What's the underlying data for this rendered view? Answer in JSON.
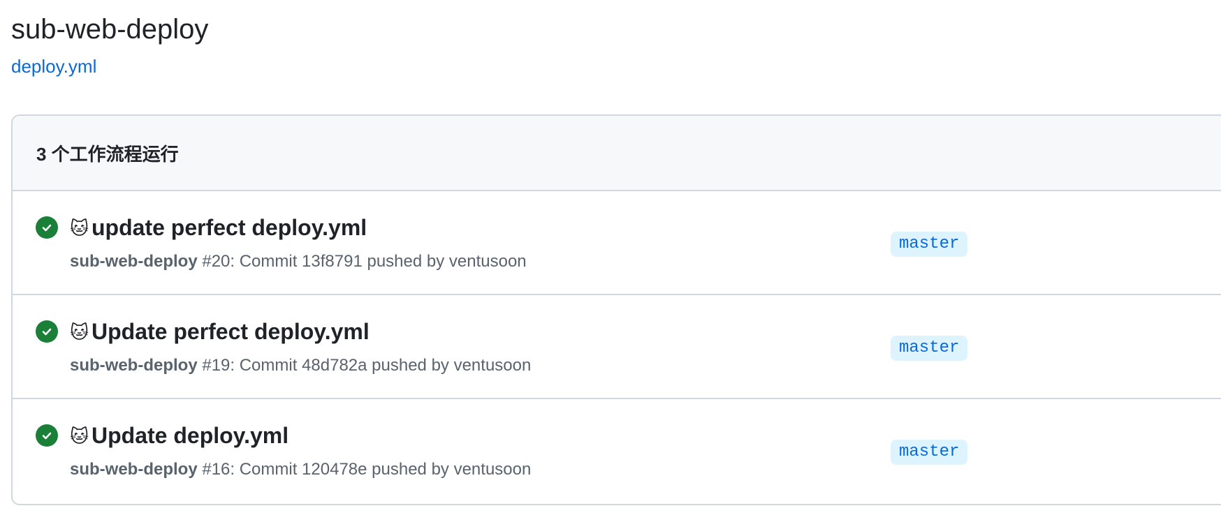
{
  "page": {
    "title": "sub-web-deploy",
    "workflow_file": "deploy.yml"
  },
  "runs_panel": {
    "count_label": "3 个工作流程运行",
    "runs": [
      {
        "status": "success",
        "emoji": "🐱",
        "title": "update perfect deploy.yml",
        "workflow": "sub-web-deploy",
        "meta": "#20: Commit 13f8791 pushed by ventusoon",
        "branch": "master"
      },
      {
        "status": "success",
        "emoji": "🐱",
        "title": "Update perfect deploy.yml",
        "workflow": "sub-web-deploy",
        "meta": "#19: Commit 48d782a pushed by ventusoon",
        "branch": "master"
      },
      {
        "status": "success",
        "emoji": "🐱",
        "title": "Update deploy.yml",
        "workflow": "sub-web-deploy",
        "meta": "#16: Commit 120478e pushed by ventusoon",
        "branch": "master"
      }
    ]
  },
  "colors": {
    "success": "#1a7f37",
    "link": "#0969da",
    "badge_bg": "#ddf4ff",
    "border": "#d0d7de",
    "header_bg": "#f6f8fa"
  },
  "icons": {
    "status": "check-circle-icon"
  }
}
